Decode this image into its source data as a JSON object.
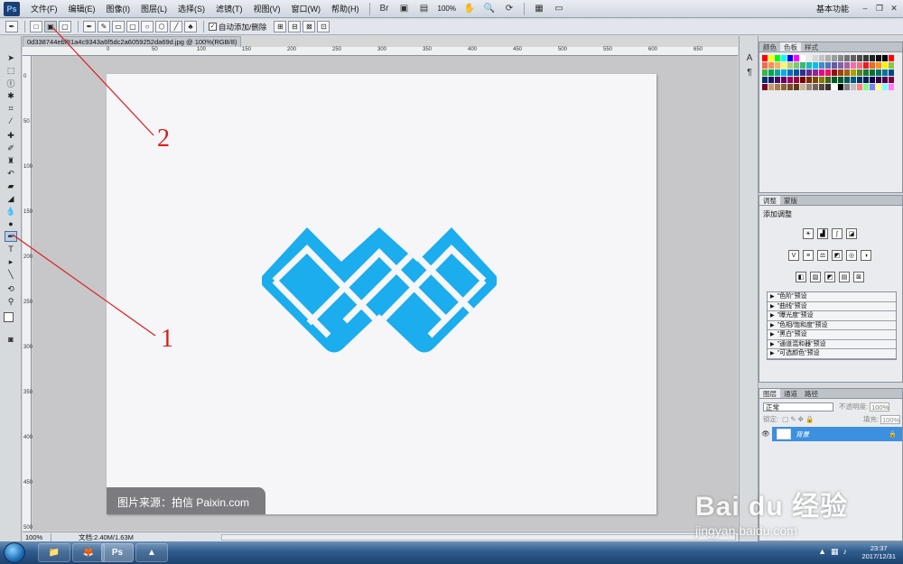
{
  "app": {
    "logo": "Ps"
  },
  "menu": [
    "文件(F)",
    "编辑(E)",
    "图像(I)",
    "图层(L)",
    "选择(S)",
    "滤镜(T)",
    "视图(V)",
    "窗口(W)",
    "帮助(H)"
  ],
  "menubar": {
    "zoom": "100%",
    "workspace": "基本功能"
  },
  "options": {
    "auto_add_label": "自动添加/删除",
    "auto_add_checked": true
  },
  "document": {
    "tab_title": "0d338744ebf81a4c9343a6f5dc2a6059252da69d.jpg @ 100%(RGB/8)",
    "ruler_h": [
      "0",
      "50",
      "100",
      "150",
      "200",
      "250",
      "300",
      "350",
      "400",
      "450",
      "500",
      "550",
      "600",
      "650",
      "700",
      "750"
    ],
    "ruler_v": [
      "0",
      "50",
      "100",
      "150",
      "200",
      "250",
      "300",
      "350",
      "400",
      "450",
      "500"
    ],
    "watermark": "图片来源：拍信 Paixin.com",
    "logo_color": "#1badee"
  },
  "status": {
    "zoom": "100%",
    "doc_size": "文档:2.40M/1.63M"
  },
  "annotations": {
    "label_1": "1",
    "label_2": "2",
    "color": "#d81e1e"
  },
  "swatches": {
    "tabs": [
      "颜色",
      "色板",
      "样式"
    ],
    "colors": [
      "#ff0000",
      "#ffff00",
      "#00ff00",
      "#00ffff",
      "#0000ff",
      "#ff00ff",
      "#ffffff",
      "#ebebeb",
      "#d7d7d7",
      "#c3c3c3",
      "#afafaf",
      "#9b9b9b",
      "#878787",
      "#737373",
      "#5f5f5f",
      "#4b4b4b",
      "#373737",
      "#232323",
      "#0f0f0f",
      "#000000",
      "#ff0000",
      "#f26c4f",
      "#f68e55",
      "#fbaf5c",
      "#fff467",
      "#acd372",
      "#7cc576",
      "#3bb878",
      "#1abbb4",
      "#00bff3",
      "#438cca",
      "#5574b9",
      "#605ca8",
      "#855fa8",
      "#a763a8",
      "#f06ea9",
      "#f26d7d",
      "#ed1c24",
      "#f26522",
      "#f7941d",
      "#fff200",
      "#8dc63f",
      "#39b54a",
      "#00a651",
      "#00a99d",
      "#00aeef",
      "#0072bc",
      "#0054a6",
      "#2e3192",
      "#662d91",
      "#92278f",
      "#ec008c",
      "#ed145b",
      "#9e0b0f",
      "#a0410d",
      "#a36209",
      "#aba000",
      "#598527",
      "#1a7b30",
      "#007236",
      "#00746b",
      "#0076a3",
      "#004a80",
      "#003471",
      "#1b1464",
      "#440e62",
      "#630460",
      "#9e005d",
      "#9e0039",
      "#790000",
      "#7b2e00",
      "#7d4900",
      "#827b00",
      "#406618",
      "#005e20",
      "#005826",
      "#005952",
      "#005b7f",
      "#003663",
      "#002157",
      "#0d004c",
      "#32004b",
      "#4b0049",
      "#7b0046",
      "#7a0026",
      "#c69c6d",
      "#a67c52",
      "#8c6239",
      "#754c24",
      "#603913",
      "#c7b299",
      "#998675",
      "#736357",
      "#534741",
      "#362f2d",
      "#ffffff",
      "#000000",
      "#808080",
      "#c0c0c0",
      "#ff8080",
      "#80ff80",
      "#8080ff",
      "#ffff80",
      "#80ffff",
      "#ff80ff"
    ]
  },
  "adjustments": {
    "tabs": [
      "调整",
      "蒙版"
    ],
    "title": "添加调整",
    "presets": [
      "\"色阶\"预设",
      "\"曲线\"预设",
      "\"曝光度\"预设",
      "\"色相/饱和度\"预设",
      "\"黑白\"预设",
      "\"通道混和器\"预设",
      "\"可选颜色\"预设"
    ]
  },
  "layers": {
    "tabs": [
      "图层",
      "通道",
      "路径"
    ],
    "blend_mode": "正常",
    "opacity_label": "不透明度:",
    "opacity": "100%",
    "lock_label": "锁定:",
    "fill_label": "填充:",
    "fill": "100%",
    "items": [
      {
        "name": "背景"
      }
    ]
  },
  "taskbar": {
    "time": "23:37",
    "date": "2017/12/31",
    "ps_label": "Ps"
  },
  "watermark_brand": {
    "logo": "Bai du 经验",
    "url": "jingyan.baidu.com"
  }
}
